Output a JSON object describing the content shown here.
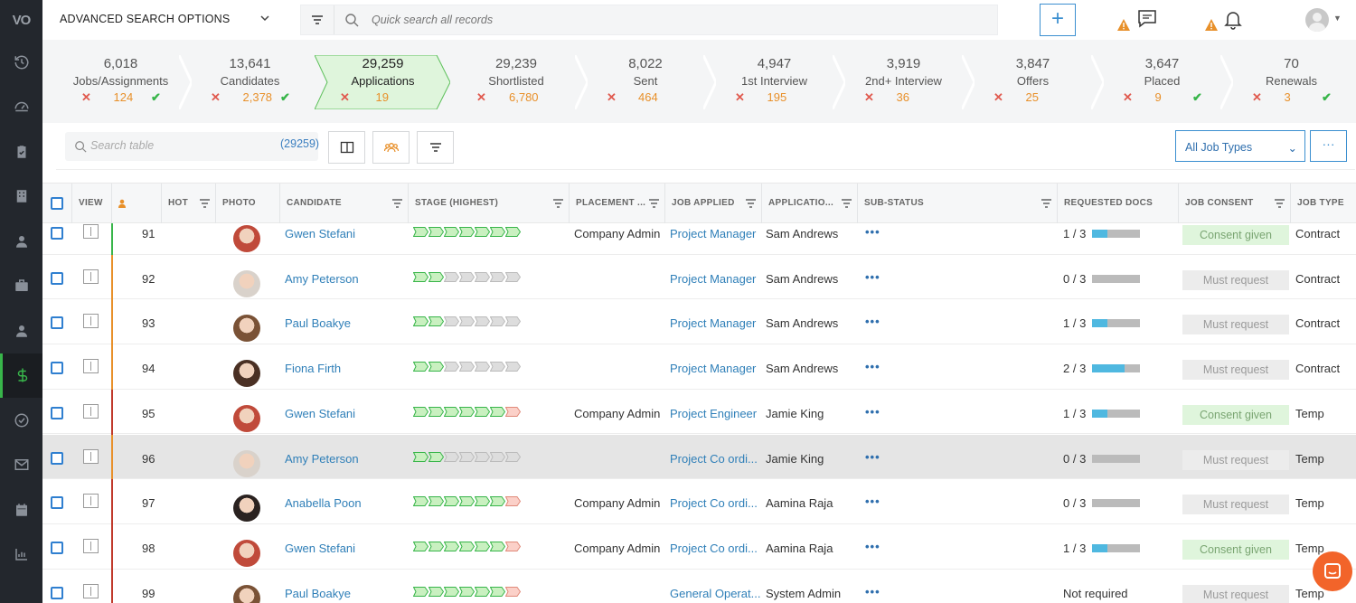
{
  "topbar": {
    "advanced_label": "ADVANCED SEARCH OPTIONS",
    "search_placeholder": "Quick search all records",
    "add_label": "+"
  },
  "pipeline": [
    {
      "name": "Jobs/Assignments",
      "count": "6,018",
      "rejected": "124",
      "ok": true
    },
    {
      "name": "Candidates",
      "count": "13,641",
      "rejected": "2,378",
      "ok": true
    },
    {
      "name": "Applications",
      "count": "29,259",
      "rejected": "19",
      "ok": false,
      "active": true
    },
    {
      "name": "Shortlisted",
      "count": "29,239",
      "rejected": "6,780",
      "ok": false
    },
    {
      "name": "Sent",
      "count": "8,022",
      "rejected": "464",
      "ok": false
    },
    {
      "name": "1st Interview",
      "count": "4,947",
      "rejected": "195",
      "ok": false
    },
    {
      "name": "2nd+ Interview",
      "count": "3,919",
      "rejected": "36",
      "ok": false
    },
    {
      "name": "Offers",
      "count": "3,847",
      "rejected": "25",
      "ok": false
    },
    {
      "name": "Placed",
      "count": "3,647",
      "rejected": "9",
      "ok": true
    },
    {
      "name": "Renewals",
      "count": "70",
      "rejected": "3",
      "ok": true
    }
  ],
  "toolbar": {
    "search_placeholder": "Search table",
    "count": "(29259)",
    "job_types": "All Job Types",
    "more": "···"
  },
  "columns": {
    "view": "VIEW",
    "hot": "HOT",
    "photo": "PHOTO",
    "candidate": "CANDIDATE",
    "stage": "STAGE (HIGHEST)",
    "placement": "PLACEMENT ...",
    "job": "JOB APPLIED",
    "applicant": "APPLICATIO...",
    "substatus": "SUB-STATUS",
    "docs": "REQUESTED DOCS",
    "consent": "JOB CONSENT",
    "type": "JOB TYPE"
  },
  "rows": [
    {
      "hot": "91",
      "name": "Gwen Stefani",
      "stage": 7,
      "stage_red": 0,
      "placement": "Company Admin",
      "job": "Project Manager",
      "applicant": "Sam Andrews",
      "docs": "1 / 3",
      "docs_fill": 0.33,
      "consent": "Consent given",
      "type": "Contract",
      "bar": "#38b54a",
      "avatar": "#c04a3a"
    },
    {
      "hot": "92",
      "name": "Amy Peterson",
      "stage": 2,
      "stage_red": 0,
      "placement": "",
      "job": "Project Manager",
      "applicant": "Sam Andrews",
      "docs": "0 / 3",
      "docs_fill": 0,
      "consent": "Must request",
      "type": "Contract",
      "bar": "#e8902a",
      "avatar": "#d9d2cb"
    },
    {
      "hot": "93",
      "name": "Paul Boakye",
      "stage": 2,
      "stage_red": 0,
      "placement": "",
      "job": "Project Manager",
      "applicant": "Sam Andrews",
      "docs": "1 / 3",
      "docs_fill": 0.33,
      "consent": "Must request",
      "type": "Contract",
      "bar": "#e8902a",
      "avatar": "#7a5236"
    },
    {
      "hot": "94",
      "name": "Fiona Firth",
      "stage": 2,
      "stage_red": 0,
      "placement": "",
      "job": "Project Manager",
      "applicant": "Sam Andrews",
      "docs": "2 / 3",
      "docs_fill": 0.67,
      "consent": "Must request",
      "type": "Contract",
      "bar": "#e8902a",
      "avatar": "#4a3024"
    },
    {
      "hot": "95",
      "name": "Gwen Stefani",
      "stage": 6,
      "stage_red": 1,
      "placement": "Company Admin",
      "job": "Project Engineer",
      "applicant": "Jamie King",
      "docs": "1 / 3",
      "docs_fill": 0.33,
      "consent": "Consent given",
      "type": "Temp",
      "bar": "#c0392b",
      "avatar": "#c04a3a"
    },
    {
      "hot": "96",
      "name": "Amy Peterson",
      "stage": 2,
      "stage_red": 0,
      "placement": "",
      "job": "Project Co ordi...",
      "applicant": "Jamie King",
      "docs": "0 / 3",
      "docs_fill": 0,
      "consent": "Must request",
      "type": "Temp",
      "bar": "#e8902a",
      "avatar": "#d9d2cb",
      "highlight": true
    },
    {
      "hot": "97",
      "name": "Anabella Poon",
      "stage": 6,
      "stage_red": 1,
      "placement": "Company Admin",
      "job": "Project Co ordi...",
      "applicant": "Aamina Raja",
      "docs": "0 / 3",
      "docs_fill": 0,
      "consent": "Must request",
      "type": "Temp",
      "bar": "#c0392b",
      "avatar": "#2a2220"
    },
    {
      "hot": "98",
      "name": "Gwen Stefani",
      "stage": 6,
      "stage_red": 1,
      "placement": "Company Admin",
      "job": "Project Co ordi...",
      "applicant": "Aamina Raja",
      "docs": "1 / 3",
      "docs_fill": 0.33,
      "consent": "Consent given",
      "type": "Temp",
      "bar": "#c0392b",
      "avatar": "#c04a3a"
    },
    {
      "hot": "99",
      "name": "Paul Boakye",
      "stage": 6,
      "stage_red": 1,
      "placement": "",
      "job": "General Operat...",
      "applicant": "System Admin",
      "docs": "Not required",
      "docs_fill": -1,
      "consent": "Must request",
      "type": "Temp",
      "bar": "#c0392b",
      "avatar": "#7a5236"
    }
  ],
  "colors": {
    "accent": "#3b8fd0",
    "green": "#38b54a",
    "orange": "#e8902a",
    "red": "#e05a4f"
  }
}
